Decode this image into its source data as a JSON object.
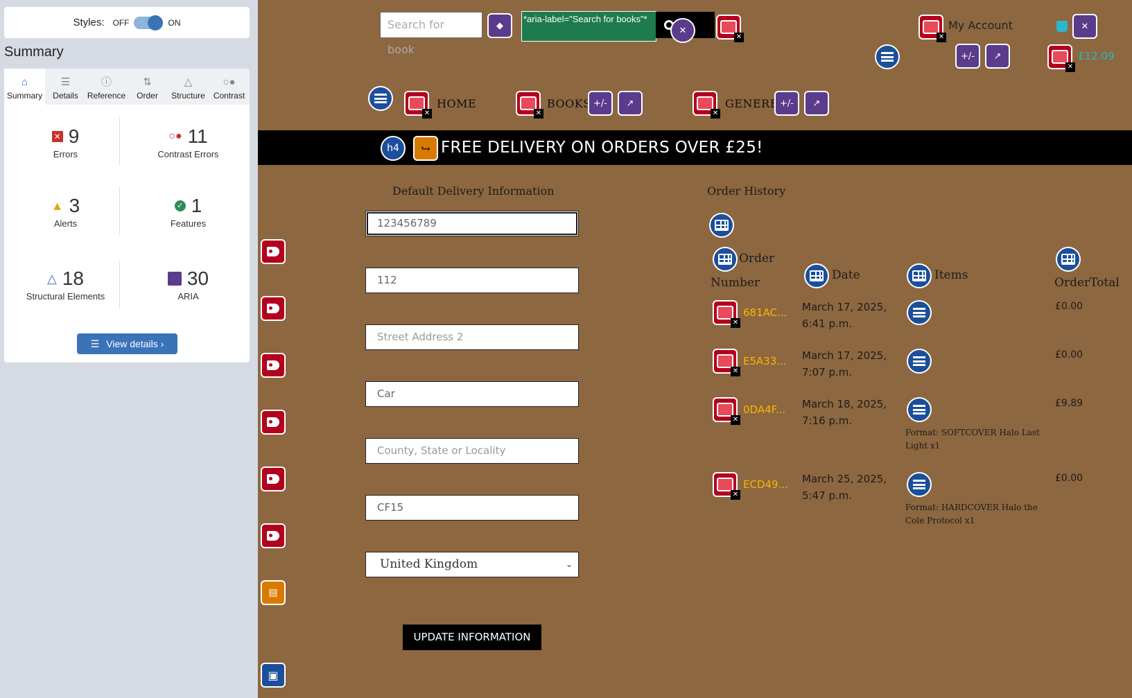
{
  "wave": {
    "styles_label": "Styles:",
    "off_label": "OFF",
    "on_label": "ON",
    "summary_title": "Summary",
    "tabs": [
      {
        "label": "Summary",
        "icon": "home-icon"
      },
      {
        "label": "Details",
        "icon": "list-icon"
      },
      {
        "label": "Reference",
        "icon": "info-icon"
      },
      {
        "label": "Order",
        "icon": "order-icon"
      },
      {
        "label": "Structure",
        "icon": "structure-icon"
      },
      {
        "label": "Contrast",
        "icon": "contrast-icon"
      }
    ],
    "stats": {
      "errors": {
        "count": "9",
        "label": "Errors"
      },
      "contrast": {
        "count": "11",
        "label": "Contrast Errors"
      },
      "alerts": {
        "count": "3",
        "label": "Alerts"
      },
      "features": {
        "count": "1",
        "label": "Features"
      },
      "structural": {
        "count": "18",
        "label": "Structural Elements"
      },
      "aria": {
        "count": "30",
        "label": "ARIA"
      }
    },
    "view_details": "View details ›",
    "colors": {
      "accent": "#3b73b9",
      "error": "#c9302c",
      "alert": "#e8a317",
      "feature": "#2e8b57",
      "aria": "#5b3b8c"
    }
  },
  "site": {
    "search_placeholder": "Search for book",
    "aria_label_tip": "*aria-label=\"Search for books\"*",
    "account": "My Account",
    "cart_total": "£12.09",
    "nav": [
      "HOME",
      "BOOKS",
      "GENERE"
    ],
    "banner_heading_badge": "h4",
    "banner": "FREE DELIVERY ON ORDERS OVER £25!",
    "colors": {
      "background": "#8d6740",
      "link": "#f5b800",
      "cart": "#2bb7c9"
    }
  },
  "delivery": {
    "title": "Default Delivery Information",
    "fields": [
      {
        "value": "123456789",
        "placeholder": ""
      },
      {
        "value": "112",
        "placeholder": ""
      },
      {
        "value": "",
        "placeholder": "Street Address 2"
      },
      {
        "value": "Car",
        "placeholder": ""
      },
      {
        "value": "",
        "placeholder": "County, State or Locality"
      },
      {
        "value": "CF15",
        "placeholder": ""
      }
    ],
    "country": "United Kingdom",
    "update_button": "UPDATE INFORMATION"
  },
  "orders": {
    "title": "Order History",
    "headers": {
      "order_top": "Order",
      "order_bottom": "Number",
      "date": "Date",
      "items": "Items",
      "total": "OrderTotal"
    },
    "rows": [
      {
        "id": "681AC...",
        "date1": "March 17, 2025,",
        "date2": "6:41 p.m.",
        "items": "",
        "total": "£0.00"
      },
      {
        "id": "E5A33...",
        "date1": "March 17, 2025,",
        "date2": "7:07 p.m.",
        "items": "",
        "total": "£0.00"
      },
      {
        "id": "0DA4F...",
        "date1": "March 18, 2025,",
        "date2": "7:16 p.m.",
        "items": "Format: SOFTCOVER Halo Last Light x1",
        "total": "£9.89"
      },
      {
        "id": "ECD49...",
        "date1": "March 25, 2025,",
        "date2": "5:47 p.m.",
        "items": "Format: HARDCOVER Halo the Cole Protocol x1",
        "total": "£0.00"
      }
    ]
  }
}
